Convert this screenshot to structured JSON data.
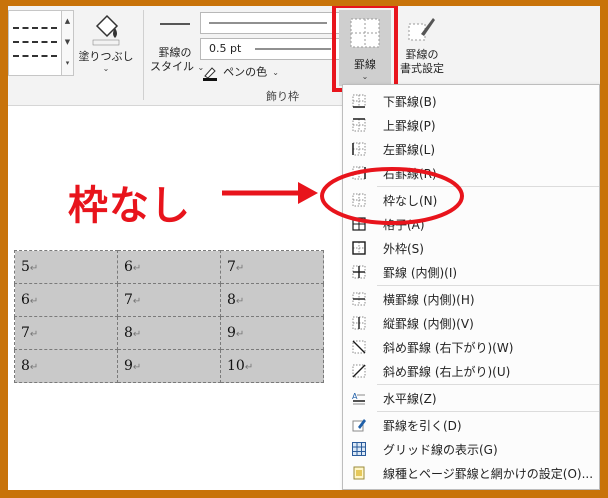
{
  "ribbon": {
    "shading_label": "塗りつぶし",
    "pen_style_label_1": "罫線の",
    "pen_style_label_2": "スタイル",
    "line_weight": "0.5 pt",
    "pen_color_label": "ペンの色",
    "group_label": "飾り枠",
    "borders_label": "罫線",
    "borders_format_label_1": "罫線の",
    "borders_format_label_2": "書式設定"
  },
  "annotation": {
    "label": "枠なし",
    "color": "#e8141c"
  },
  "table": {
    "rows": [
      [
        "5",
        "6",
        "7"
      ],
      [
        "6",
        "7",
        "8"
      ],
      [
        "7",
        "8",
        "9"
      ],
      [
        "8",
        "9",
        "10"
      ]
    ],
    "paragraph_mark": "↵"
  },
  "menu": {
    "items": [
      {
        "label": "下罫線(B)",
        "icon": "bottom-border-icon"
      },
      {
        "label": "上罫線(P)",
        "icon": "top-border-icon"
      },
      {
        "label": "左罫線(L)",
        "icon": "left-border-icon"
      },
      {
        "label": "右罫線(R)",
        "icon": "right-border-icon"
      },
      {
        "label": "枠なし(N)",
        "icon": "no-border-icon"
      },
      {
        "label": "格子(A)",
        "icon": "all-borders-icon"
      },
      {
        "label": "外枠(S)",
        "icon": "outside-borders-icon"
      },
      {
        "label": "罫線 (内側)(I)",
        "icon": "inside-borders-icon"
      },
      {
        "label": "横罫線 (内側)(H)",
        "icon": "inside-horizontal-border-icon"
      },
      {
        "label": "縦罫線 (内側)(V)",
        "icon": "inside-vertical-border-icon"
      },
      {
        "label": "斜め罫線 (右下がり)(W)",
        "icon": "diagonal-down-border-icon"
      },
      {
        "label": "斜め罫線 (右上がり)(U)",
        "icon": "diagonal-up-border-icon"
      },
      {
        "label": "水平線(Z)",
        "icon": "horizontal-line-icon"
      },
      {
        "label": "罫線を引く(D)",
        "icon": "draw-table-icon"
      },
      {
        "label": "グリッド線の表示(G)",
        "icon": "view-gridlines-icon"
      },
      {
        "label": "線種とページ罫線と網かけの設定(O)...",
        "icon": "borders-shading-dialog-icon"
      }
    ]
  }
}
